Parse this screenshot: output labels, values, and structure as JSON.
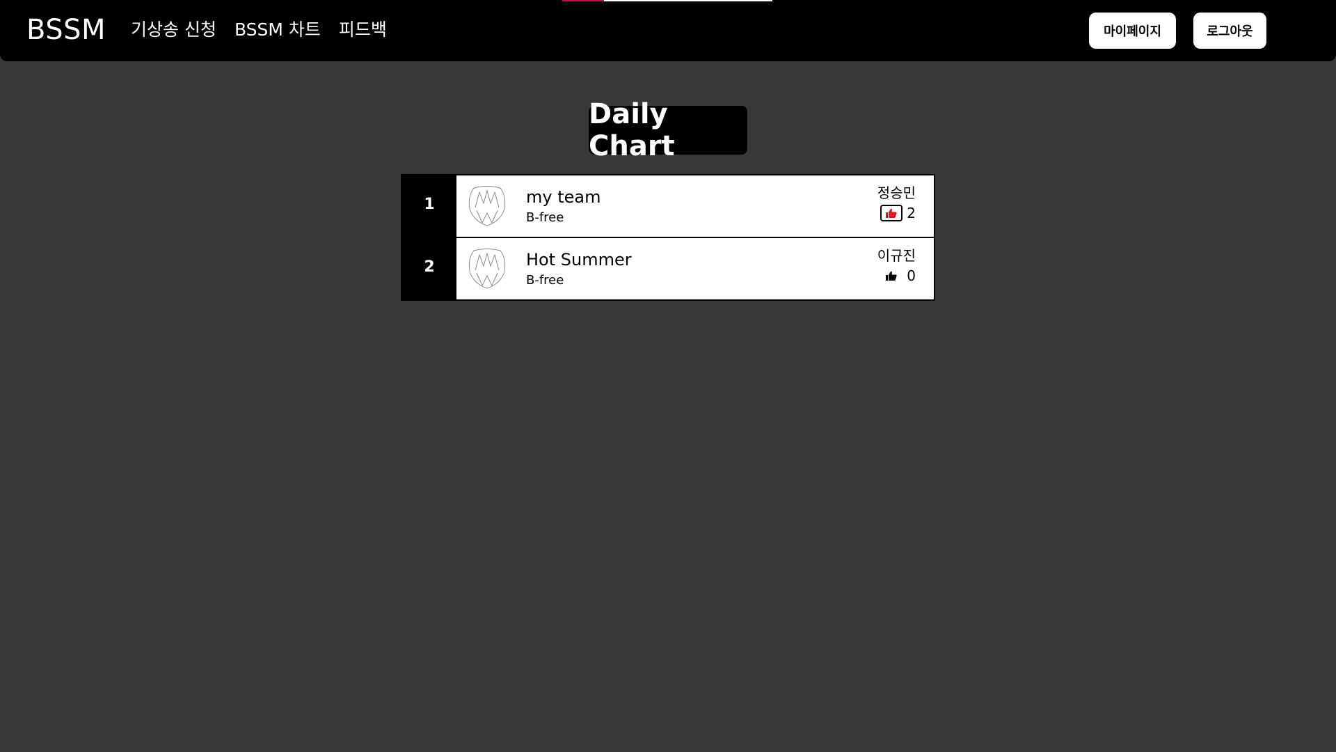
{
  "header": {
    "brand": "BSSM",
    "nav": [
      {
        "label": "기상송 신청"
      },
      {
        "label": "BSSM 차트"
      },
      {
        "label": "피드백"
      }
    ],
    "mypage_label": "마이페이지",
    "logout_label": "로그아웃",
    "progress_fraction": 0.2
  },
  "main": {
    "title": "Daily Chart",
    "songs": [
      {
        "rank": "1",
        "title": "my team",
        "artist": "B-free",
        "requester": "정승민",
        "likes": "2",
        "liked": true
      },
      {
        "rank": "2",
        "title": "Hot Summer",
        "artist": "B-free",
        "requester": "이규진",
        "likes": "0",
        "liked": false
      }
    ]
  },
  "icons": {
    "thumbnail": "bfree-logo-icon",
    "like": "thumbs-up-icon"
  },
  "colors": {
    "background": "#383838",
    "navbar": "#000000",
    "like_active": "#e0141e",
    "like_inactive": "#000000",
    "progress_fill": "#c1124a"
  }
}
